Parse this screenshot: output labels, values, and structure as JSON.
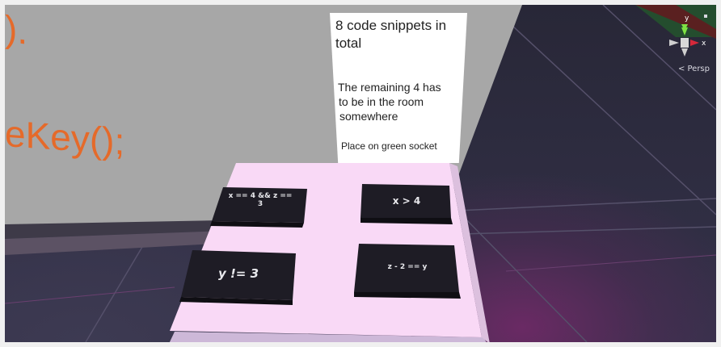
{
  "hint_card": {
    "line1": "8 code snippets in",
    "line2": "total",
    "line3": "The remaining 4 has",
    "line4": "to be in the room",
    "line5": "somewhere",
    "line6": "Place on green socket"
  },
  "wall_code": {
    "top_fragment": ").",
    "bottom_fragment": "eKey();"
  },
  "snippets": [
    {
      "label_line1": "x == 4 && z ==",
      "label_line2": "3"
    },
    {
      "label": "x > 4"
    },
    {
      "label": "y != 3"
    },
    {
      "label": "z - 2 == y"
    }
  ],
  "gizmo": {
    "y_axis_label": "y",
    "x_axis_label": "x",
    "projection_label": "< Persp"
  },
  "colors": {
    "wall_gray": "#a7a7a7",
    "wall_code_orange": "#e56a2a",
    "tray_pink": "#f9d9f6",
    "block_dark": "#1e1c25",
    "gizmo_y_green": "#7ee243",
    "gizmo_x_red": "#d6283a",
    "floor_glow_purple": "#6a2a64"
  }
}
